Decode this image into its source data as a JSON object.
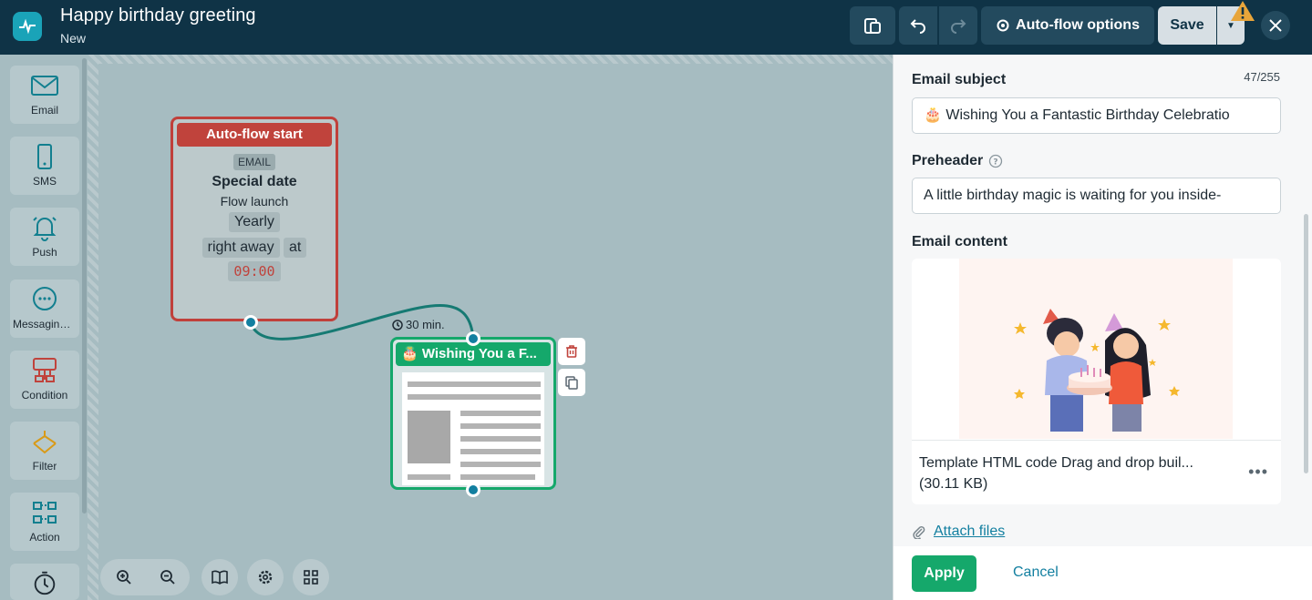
{
  "header": {
    "title": "Happy birthday greeting",
    "subtitle": "New",
    "options_label": "Auto-flow options",
    "save_label": "Save",
    "accent": "#0f3346"
  },
  "palette": {
    "items": [
      {
        "label": "Email",
        "icon": "envelope-icon"
      },
      {
        "label": "SMS",
        "icon": "phone-icon"
      },
      {
        "label": "Push",
        "icon": "bell-icon"
      },
      {
        "label": "Messaging apps",
        "icon": "chat-icon"
      },
      {
        "label": "Condition",
        "icon": "condition-icon"
      },
      {
        "label": "Filter",
        "icon": "filter-icon"
      },
      {
        "label": "Action",
        "icon": "action-icon"
      }
    ]
  },
  "start_node": {
    "header": "Auto-flow start",
    "tag": "EMAIL",
    "type": "Special date",
    "launch": "Flow launch",
    "frequency": "Yearly",
    "when": "right away",
    "at": "at",
    "time": "09:00",
    "color": "#c0433c"
  },
  "delay": {
    "label": "30 min."
  },
  "email_node": {
    "header": "🎂 Wishing You a F...",
    "color": "#15a86b"
  },
  "panel": {
    "subject_label": "Email subject",
    "subject_counter": "47/255",
    "subject_value": "🎂 Wishing You a Fantastic Birthday Celebratio",
    "preheader_label": "Preheader",
    "preheader_value": "A little birthday magic is waiting for you inside-",
    "content_label": "Email content",
    "template_name": "Template HTML code Drag and drop buil...",
    "template_size": "(30.11 KB)",
    "attach_label": "Attach files",
    "apply_label": "Apply",
    "cancel_label": "Cancel"
  }
}
